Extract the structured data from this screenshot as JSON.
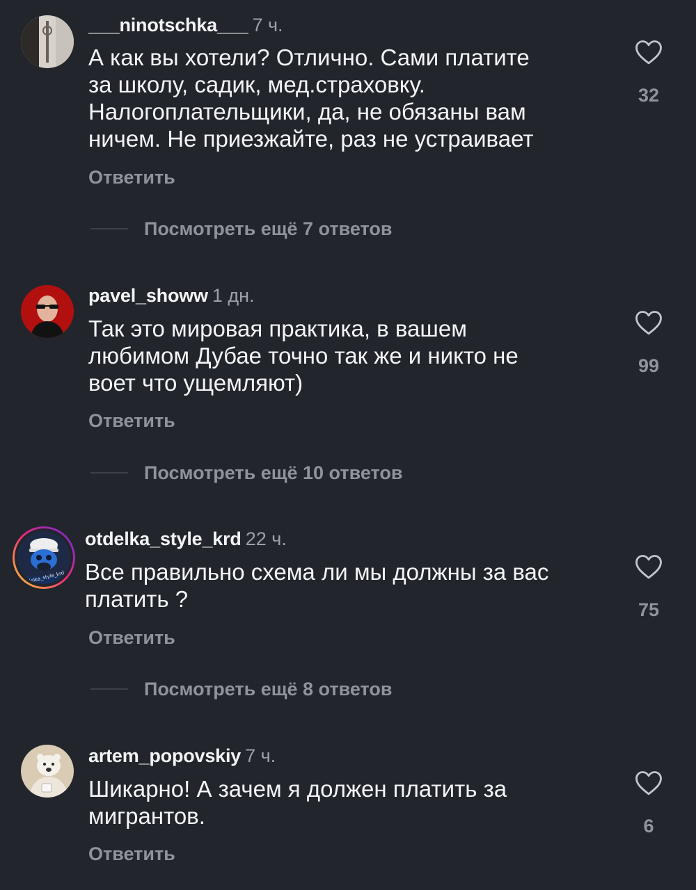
{
  "comments": [
    {
      "username": "___ninotschka___",
      "time": "7 ч.",
      "text": "А как вы хотели? Отлично. Сами платите\nза школу, садик, мед.страховку.\nНалогоплательщики, да, не обязаны вам\nничем. Не приезжайте, раз не устраивает",
      "reply": "Ответить",
      "more_replies": "Посмотреть ещё 7 ответов",
      "likes": "32"
    },
    {
      "username": "pavel_showw",
      "time": "1 дн.",
      "text": "Так это мировая практика, в вашем\nлюбимом Дубае точно так же и никто не\nвоет что ущемляют)",
      "reply": "Ответить",
      "more_replies": "Посмотреть ещё 10 ответов",
      "likes": "99"
    },
    {
      "username": "otdelka_style_krd",
      "time": "22 ч.",
      "text": "Все правильно схема ли мы должны за вас\nплатить ?",
      "reply": "Ответить",
      "more_replies": "Посмотреть ещё 8 ответов",
      "likes": "75"
    },
    {
      "username": "artem_popovskiy",
      "time": "7 ч.",
      "text": "Шикарно! А зачем я должен платить за\nмигрантов.",
      "reply": "Ответить",
      "likes": "6"
    }
  ],
  "avatar_text": "otdelka_style_krd",
  "icons": {
    "like": "heart-outline-icon"
  },
  "colors": {
    "background": "#22252c",
    "text": "#f3f4f6",
    "muted": "#8f939b",
    "story_ring": [
      "#f9ce34",
      "#ee2a7b",
      "#6228d7"
    ]
  }
}
